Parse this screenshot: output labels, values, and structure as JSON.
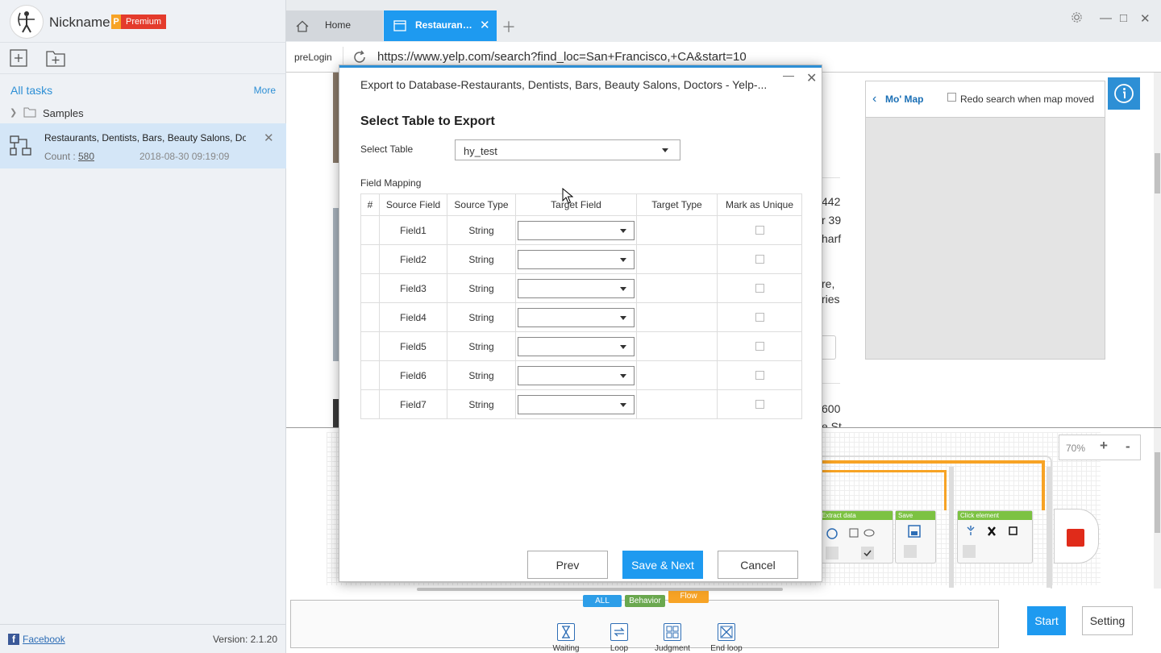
{
  "app": {
    "nickname": "Nickname",
    "premium_badge_p": "P",
    "premium_badge": "Premium",
    "version": "Version: 2.1.20",
    "facebook": "Facebook"
  },
  "sidebar": {
    "all_tasks": "All tasks",
    "more": "More",
    "folder": "Samples",
    "task": {
      "name": "Restaurants, Dentists, Bars, Beauty Salons, Doctors - Yelp",
      "count_label": "Count :",
      "count": "580",
      "date": "2018-08-30 09:19:09"
    }
  },
  "tabs": {
    "home": "Home",
    "active": "Restaurants, Dentists, Bars"
  },
  "addressbar": {
    "prelogin": "preLogin",
    "url": "https://www.yelp.com/search?find_loc=San+Francisco,+CA&start=10"
  },
  "page": {
    "map_back": "Mo' Map",
    "redo_search": "Redo search when map moved",
    "fragments": [
      "442",
      "r 39",
      "harf",
      "re,",
      "ries",
      "600",
      "e St"
    ]
  },
  "modal": {
    "title": "Export to Database-Restaurants, Dentists, Bars, Beauty Salons, Doctors - Yelp-...",
    "heading": "Select Table to Export",
    "select_label": "Select Table",
    "selected_table": "hy_test",
    "field_mapping_label": "Field Mapping",
    "columns": [
      "#",
      "Source Field",
      "Source Type",
      "Target Field",
      "Target Type",
      "Mark as Unique"
    ],
    "rows": [
      {
        "source": "Field1",
        "type": "String"
      },
      {
        "source": "Field2",
        "type": "String"
      },
      {
        "source": "Field3",
        "type": "String"
      },
      {
        "source": "Field4",
        "type": "String"
      },
      {
        "source": "Field5",
        "type": "String"
      },
      {
        "source": "Field6",
        "type": "String"
      },
      {
        "source": "Field7",
        "type": "String"
      }
    ],
    "prev": "Prev",
    "save_next": "Save & Next",
    "cancel": "Cancel"
  },
  "workflow": {
    "zoom": "70%",
    "zoom_in": "+",
    "zoom_out": "-",
    "nodes": [
      "Extract data",
      "Save",
      "Click element"
    ]
  },
  "palette": {
    "tabs": [
      "ALL",
      "Behavior",
      "Flow"
    ],
    "items": [
      "Waiting",
      "Loop",
      "Judgment",
      "End loop"
    ]
  },
  "actions": {
    "start": "Start",
    "setting": "Setting"
  },
  "colors": {
    "accent": "#1e9af0",
    "premium_red": "#e43b2c",
    "premium_orange": "#f7a325",
    "node_green": "#7cc242",
    "stop_red": "#e02b1a"
  }
}
